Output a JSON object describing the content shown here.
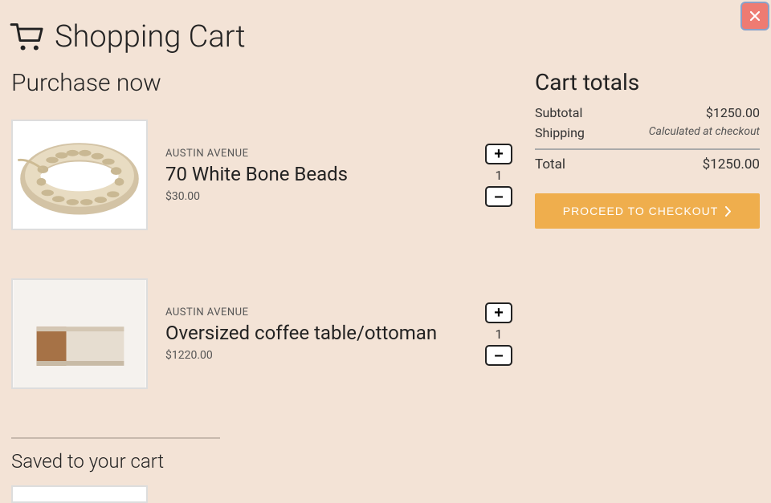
{
  "page_title": "Shopping Cart",
  "purchase_heading": "Purchase now",
  "saved_heading": "Saved to your cart",
  "items": [
    {
      "brand": "AUSTIN AVENUE",
      "name": "70 White Bone Beads",
      "price": "$30.00",
      "qty": "1"
    },
    {
      "brand": "AUSTIN AVENUE",
      "name": "Oversized coffee table/ottoman",
      "price": "$1220.00",
      "qty": "1"
    }
  ],
  "totals": {
    "title": "Cart totals",
    "subtotal_label": "Subtotal",
    "subtotal_value": "$1250.00",
    "shipping_label": "Shipping",
    "shipping_value": "Calculated at checkout",
    "total_label": "Total",
    "total_value": "$1250.00"
  },
  "checkout_label": "PROCEED TO CHECKOUT",
  "qty_plus": "+",
  "qty_minus": "–"
}
